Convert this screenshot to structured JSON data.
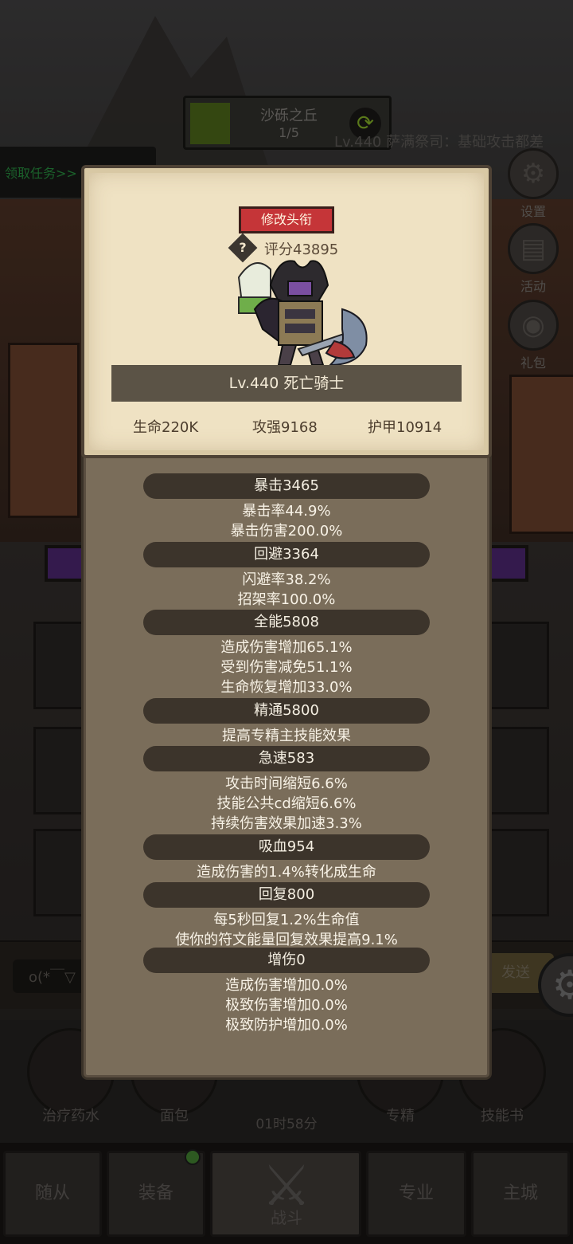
{
  "stage": {
    "name": "沙砾之丘",
    "progress": "1/5"
  },
  "quest": {
    "label": "领取任务>>"
  },
  "enemy": {
    "label": "Lv.440 萨满祭司：基础攻击都差"
  },
  "side_menu": {
    "settings": "设置",
    "activity": "活动",
    "gift": "礼包"
  },
  "chat": {
    "input_value": "o(*￣▽",
    "send": "发送"
  },
  "skills": [
    {
      "label": "治疗药水"
    },
    {
      "label": "面包"
    },
    {
      "label": "专精"
    },
    {
      "label": "技能书"
    }
  ],
  "timer": "01时58分",
  "nav": {
    "followers": "随从",
    "equipment": "装备",
    "battle": "战斗",
    "profession": "专业",
    "city": "主城"
  },
  "character": {
    "rename_button": "修改头衔",
    "help_icon": "?",
    "score": "评分43895",
    "name": "Lv.440 死亡骑士",
    "hp": "生命220K",
    "attack": "攻强9168",
    "armor": "护甲10914"
  },
  "stats": [
    {
      "title": "暴击3465",
      "lines": [
        "暴击率44.9%",
        "暴击伤害200.0%"
      ]
    },
    {
      "title": "回避3364",
      "lines": [
        "闪避率38.2%",
        "招架率100.0%"
      ]
    },
    {
      "title": "全能5808",
      "lines": [
        "造成伤害增加65.1%",
        "受到伤害减免51.1%",
        "生命恢复增加33.0%"
      ]
    },
    {
      "title": "精通5800",
      "lines": [
        "提高专精主技能效果"
      ]
    },
    {
      "title": "急速583",
      "lines": [
        "攻击时间缩短6.6%",
        "技能公共cd缩短6.6%",
        "持续伤害效果加速3.3%"
      ]
    },
    {
      "title": "吸血954",
      "lines": [
        "造成伤害的1.4%转化成生命"
      ]
    },
    {
      "title": "回复800",
      "lines": [
        "每5秒回复1.2%生命值",
        "使你的符文能量回复效果提高9.1%"
      ]
    },
    {
      "title": "增伤0",
      "lines": [
        "造成伤害增加0.0%",
        "极致伤害增加0.0%",
        "极致防护增加0.0%"
      ]
    }
  ],
  "colors": {
    "rename_button": "#c53538",
    "panel": "#7a6d5a",
    "card": "#efe2c3",
    "section_bar": "#3c342b",
    "quest_text": "#2ea84a"
  }
}
